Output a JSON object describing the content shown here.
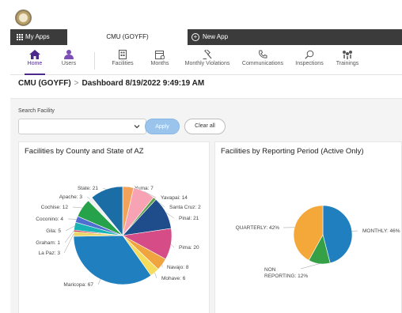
{
  "tabs": {
    "my_apps": "My Apps",
    "active": "CMU (GOYFF)",
    "new_app": "New App"
  },
  "nav": {
    "items": [
      {
        "label": "Home",
        "icon": "home-icon"
      },
      {
        "label": "Users",
        "icon": "users-icon"
      },
      {
        "label": "Facilities",
        "icon": "building-icon"
      },
      {
        "label": "Months",
        "icon": "calendar-icon"
      },
      {
        "label": "Monthly Violations",
        "icon": "gavel-icon"
      },
      {
        "label": "Communications",
        "icon": "phone-icon"
      },
      {
        "label": "Inspections",
        "icon": "magnifier-icon"
      },
      {
        "label": "Trainings",
        "icon": "training-icon"
      }
    ],
    "active_color": "#4b2a8a"
  },
  "breadcrumb": {
    "root": "CMU (GOYFF)",
    "separator": ">",
    "current": "Dashboard 8/19/2022 9:49:19 AM"
  },
  "search": {
    "label": "Search Facility",
    "value": "",
    "apply_label": "Apply",
    "clear_label": "Clear all"
  },
  "colors": {
    "apply_button": "#9ac4ec",
    "nav_accent": "#4b2a8a",
    "tab_bar": "#3b3b3b"
  },
  "chart_data": [
    {
      "type": "pie",
      "title": "Facilities by County and State of AZ",
      "labels": [
        "Yuma",
        "Yavapai",
        "Santa Cruz",
        "Pinal",
        "Pima",
        "Navajo",
        "Mohave",
        "Maricopa",
        "La Paz",
        "Graham",
        "Gila",
        "Coconino",
        "Cochise",
        "Apache",
        "State"
      ],
      "values": [
        7,
        14,
        2,
        21,
        20,
        8,
        6,
        67,
        3,
        1,
        5,
        4,
        12,
        3,
        21
      ],
      "display": [
        "Yuma: 7",
        "Yavapai: 14",
        "Santa Cruz: 2",
        "Pinal: 21",
        "Pima: 20",
        "Navajo: 8",
        "Mohave: 6",
        "Maricopa: 67",
        "La Paz: 3",
        "Graham: 1",
        "Gila: 5",
        "Coconino: 4",
        "Cochise: 12",
        "Apache: 3",
        "State: 21"
      ],
      "colors": [
        "#f2a25a",
        "#f7a3b3",
        "#5ba04a",
        "#1f4c8a",
        "#d64c86",
        "#f0a440",
        "#f5dc5c",
        "#1f7fbf",
        "#e9d56a",
        "#cc2d46",
        "#1ab3b3",
        "#4e6fcf",
        "#25a24a",
        "#f0f0f0",
        "#1a6ea5"
      ]
    },
    {
      "type": "pie",
      "title": "Facilities by Reporting Period (Active Only)",
      "labels": [
        "MONTHLY",
        "NON REPORTING",
        "QUARTERLY"
      ],
      "values": [
        46,
        12,
        42
      ],
      "display": [
        "MONTHLY: 46%",
        "NON REPORTING: 12%",
        "QUARTERLY: 42%"
      ],
      "colors": [
        "#1f7fbf",
        "#35a046",
        "#f5a83a"
      ]
    }
  ]
}
